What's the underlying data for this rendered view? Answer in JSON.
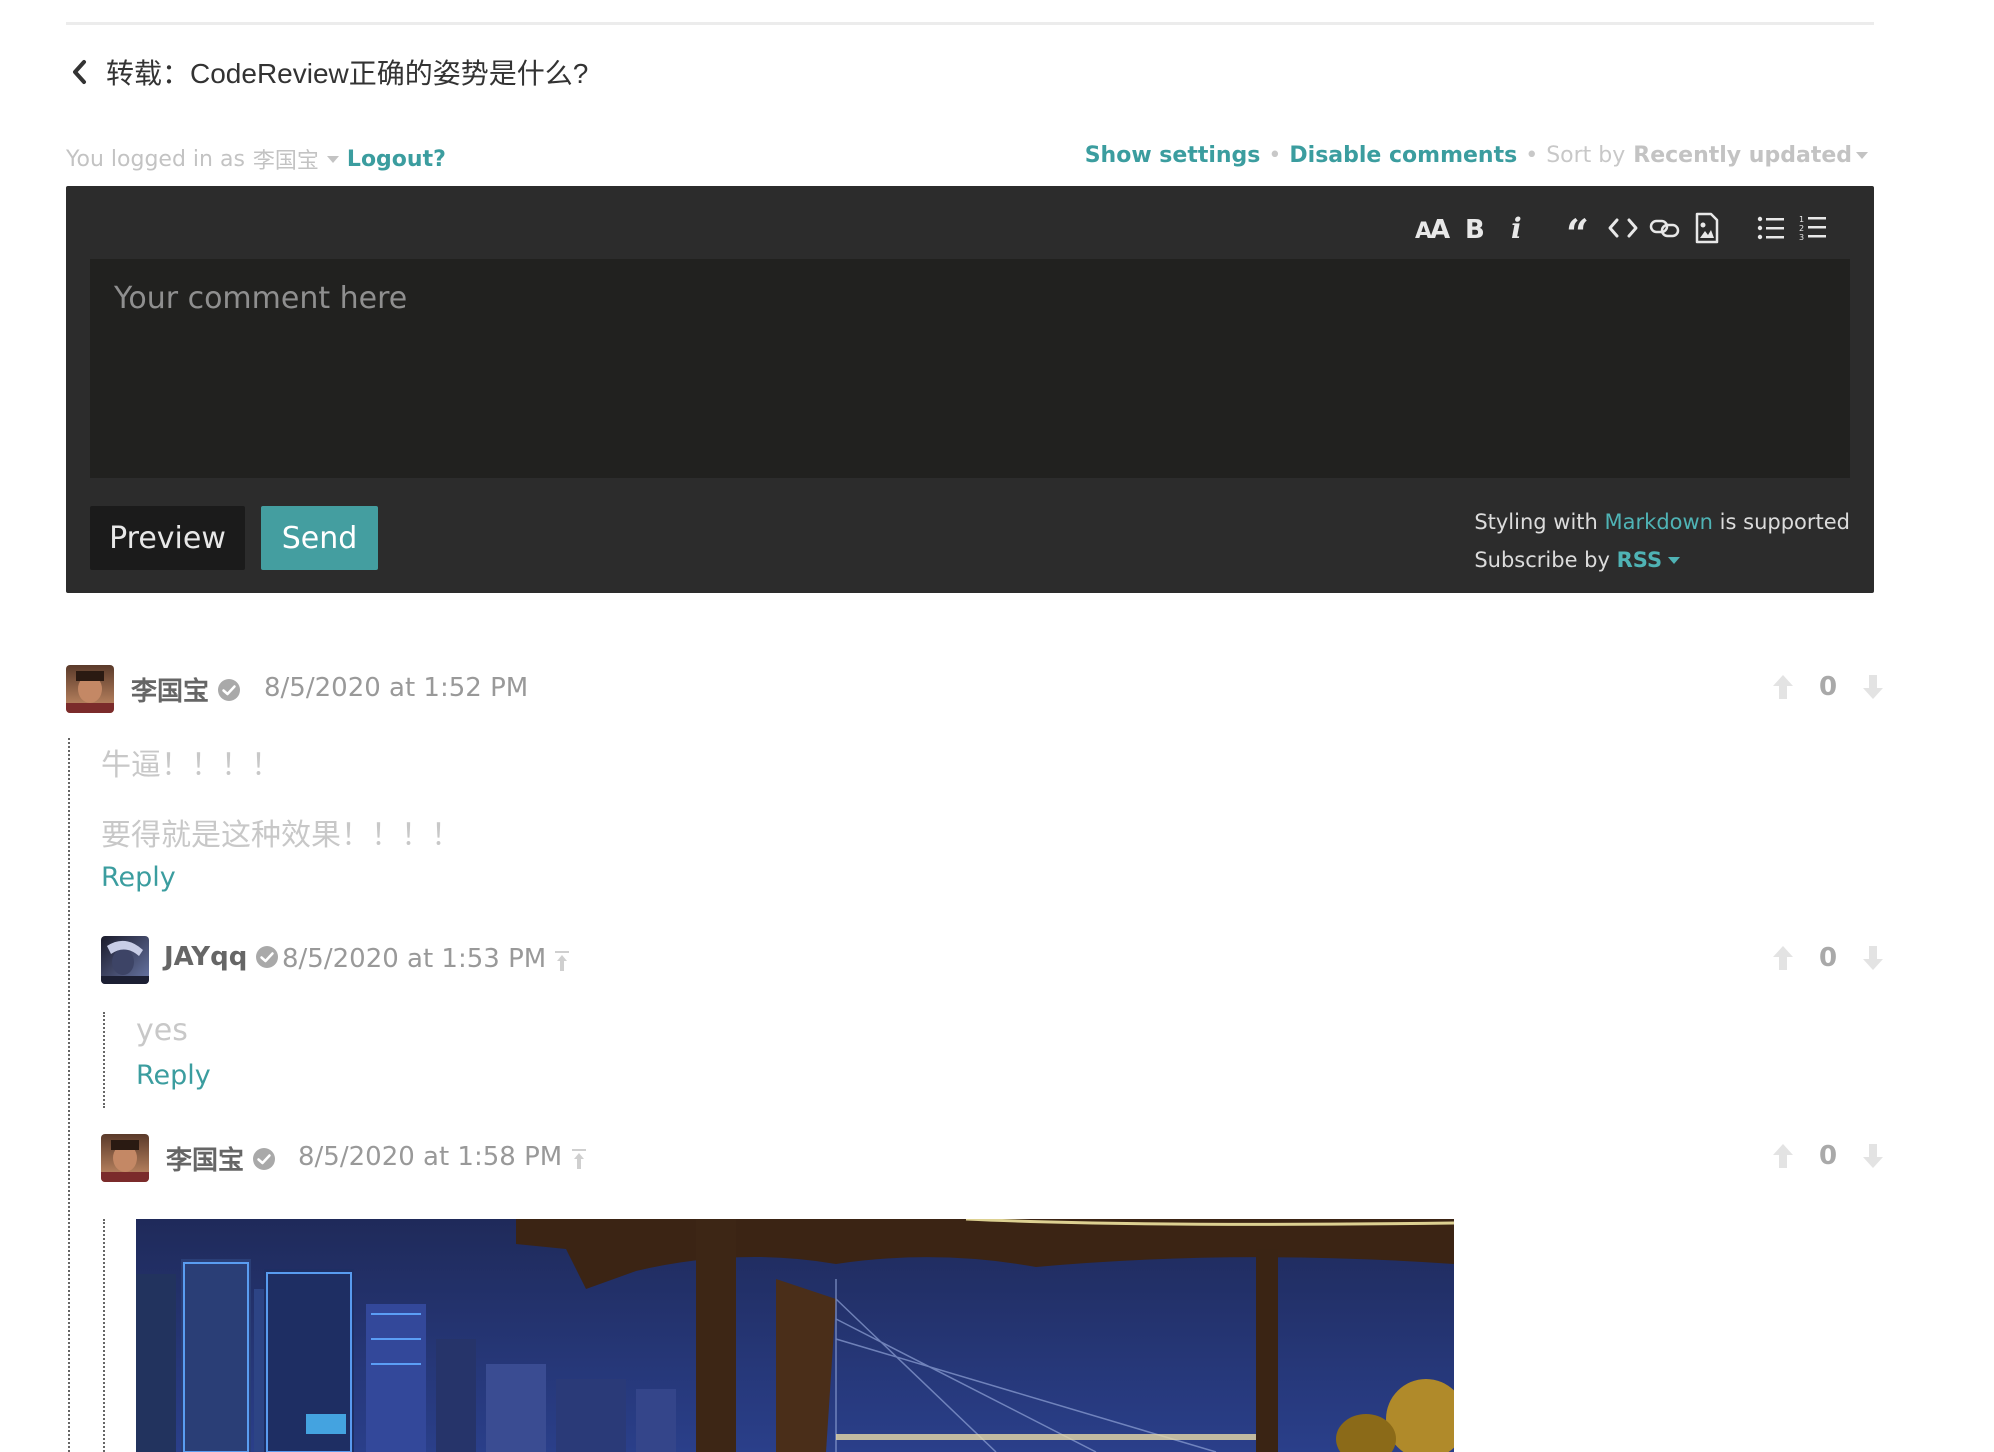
{
  "post": {
    "title": "转载：CodeReview正确的姿势是什么?"
  },
  "auth": {
    "logged_prefix": "You logged in as",
    "username": "李国宝",
    "logout": "Logout?"
  },
  "controls": {
    "show_settings": "Show settings",
    "disable_comments": "Disable comments",
    "sort_by": "Sort by",
    "sort_value": "Recently updated"
  },
  "editor": {
    "placeholder": "Your comment here",
    "toolbar": [
      "text-size-icon",
      "bold-icon",
      "italic-icon",
      "quote-icon",
      "code-icon",
      "link-icon",
      "image-icon",
      "bullet-list-icon",
      "numbered-list-icon"
    ],
    "preview_label": "Preview",
    "send_label": "Send",
    "styling_prefix": "Styling with",
    "styling_link": "Markdown",
    "styling_suffix": "is supported",
    "subscribe_prefix": "Subscribe by",
    "subscribe_link": "RSS"
  },
  "comments": [
    {
      "author": "李国宝",
      "time": "8/5/2020 at 1:52 PM",
      "votes": "0",
      "lines": [
        "牛逼！！！！",
        "要得就是这种效果！！！！"
      ],
      "reply": "Reply"
    },
    {
      "author": "JAYqq",
      "time": "8/5/2020 at 1:53 PM",
      "votes": "0",
      "lines": [
        "yes"
      ],
      "reply": "Reply"
    },
    {
      "author": "李国宝",
      "time": "8/5/2020 at 1:58 PM",
      "votes": "0"
    }
  ],
  "colors": {
    "accent": "#3b9d9f",
    "editor_bg": "#2c2c2c",
    "textarea_bg": "#21211f",
    "send_bg": "#449ea0"
  }
}
